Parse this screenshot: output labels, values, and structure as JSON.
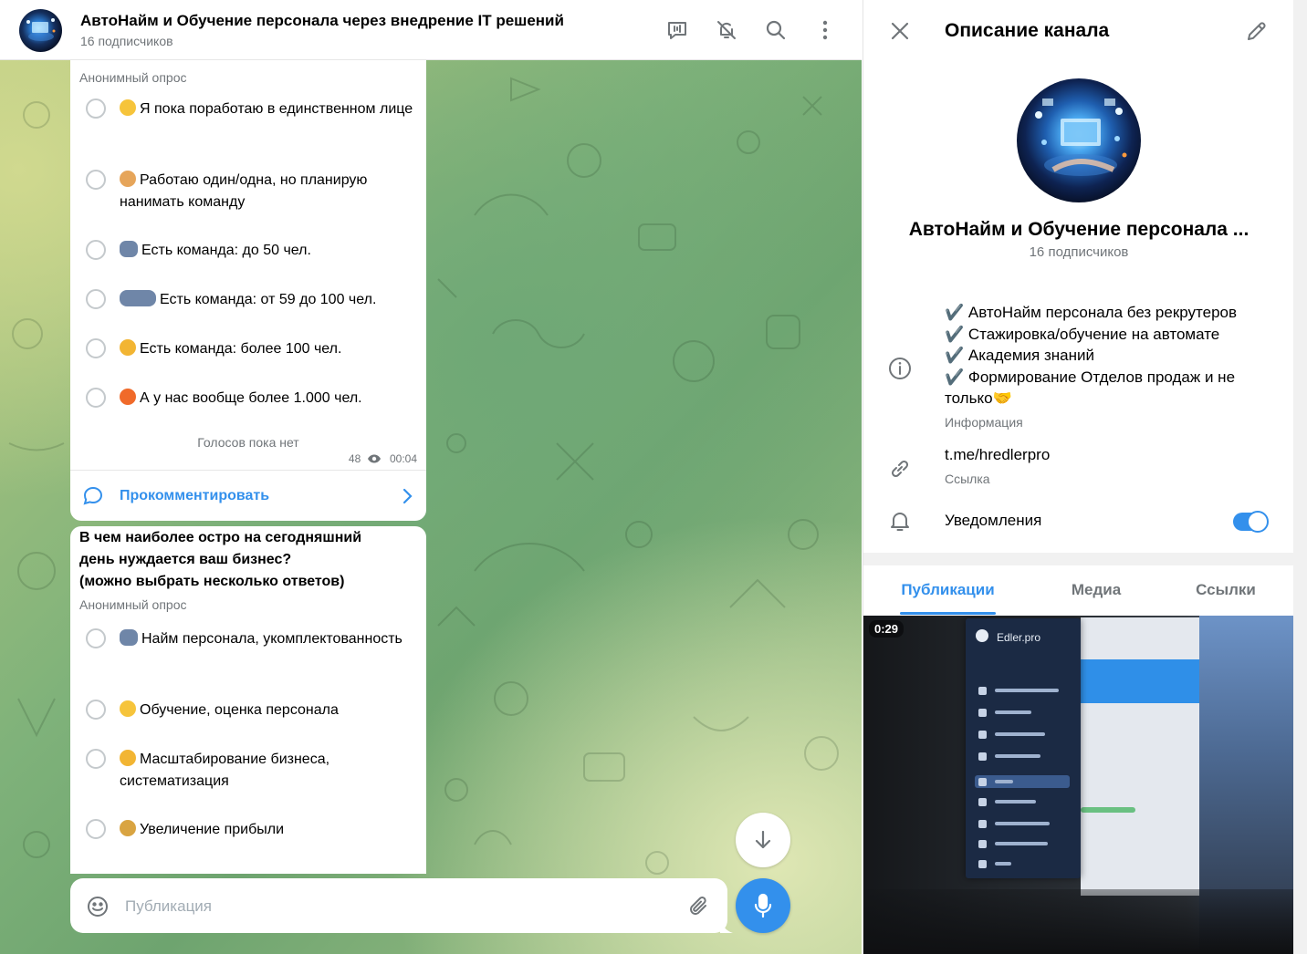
{
  "chat": {
    "title": "АвтоНайм и Обучение персонала через внедрение IT решений",
    "subscribers": "16 подписчиков"
  },
  "poll1": {
    "type": "Анонимный опрос",
    "options": [
      {
        "emoji": "nerd-face-emoji",
        "text": "Я пока поработаю в единственном лице"
      },
      {
        "emoji": "technologist-emoji",
        "text": "Работаю один/одна, но планирую нанимать команду"
      },
      {
        "emoji": "two-people-emoji",
        "text": "Есть команда: до 50 чел."
      },
      {
        "emoji": "group-emoji",
        "text": "Есть команда: от 59 до 100 чел."
      },
      {
        "emoji": "flexed-biceps-emoji",
        "text": "Есть команда: более 100 чел."
      },
      {
        "emoji": "fire-emoji",
        "text": "А у нас вообще более 1.000 чел."
      }
    ],
    "votes_status": "Голосов пока нет",
    "views": "48",
    "time": "00:04",
    "comment_label": "Прокомментировать"
  },
  "poll2": {
    "question": "В чем наиболее остро на сегодняшний день нуждается ваш бизнес? (можно выбрать несколько ответов)",
    "question_lines": [
      "В чем наиболее остро на сегодняшний",
      "день нуждается ваш бизнес?",
      "(можно выбрать несколько ответов)"
    ],
    "type": "Анонимный опрос",
    "options": [
      {
        "emoji": "two-people-emoji",
        "text": "Найм персонала, укомплектованность"
      },
      {
        "emoji": "nerd-face-emoji",
        "text": "Обучение, оценка персонала"
      },
      {
        "emoji": "flexed-biceps-emoji",
        "text": "Масштабирование бизнеса, систематизация"
      },
      {
        "emoji": "money-bag-emoji",
        "text": "Увеличение прибыли"
      }
    ]
  },
  "composer": {
    "placeholder": "Публикация"
  },
  "side": {
    "title": "Описание канала",
    "channel_name": "АвтоНайм и Обучение персонала ...",
    "subscribers": "16 подписчиков",
    "description_lines": [
      "✔️ АвтоНайм персонала без рекрутеров",
      "✔️ Стажировка/обучение на автомате",
      "✔️ Академия знаний",
      "✔️ Формирование Отделов продаж и не",
      "только🤝"
    ],
    "description_label": "Информация",
    "link": "t.me/hredlerpro",
    "link_label": "Ссылка",
    "notifications_label": "Уведомления",
    "notifications_on": true,
    "tabs": [
      "Публикации",
      "Медиа",
      "Ссылки"
    ],
    "active_tab": "Публикации",
    "media": {
      "duration": "0:29",
      "screen_brand": "Edler.pro"
    }
  },
  "colors": {
    "accent": "#3390ec",
    "secondary_text": "#707579",
    "bubble": "#ffffff"
  }
}
